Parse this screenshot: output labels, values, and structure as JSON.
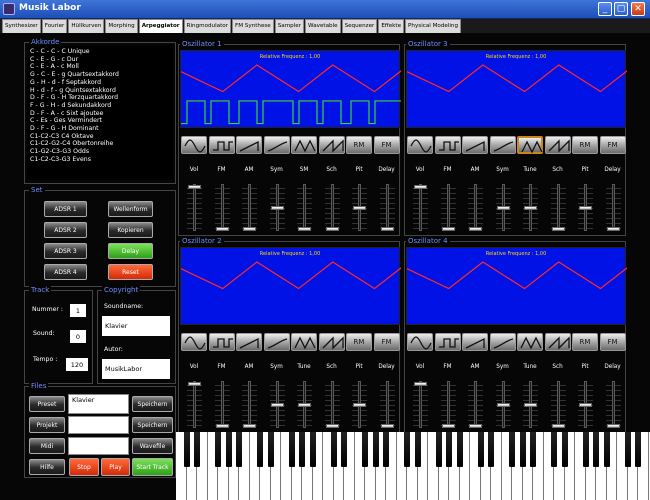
{
  "window": {
    "title": "Musik Labor"
  },
  "tabs": [
    "Synthesizer",
    "Fourier",
    "Hüllkurven",
    "Morphing",
    "Arpeggiator",
    "Ringmodulator",
    "FM Synthese",
    "Sampler",
    "Wavetable",
    "Sequenzer",
    "Effekte",
    "Physical Modeling"
  ],
  "active_tab": 4,
  "chords": {
    "title": "Akkorde",
    "items": [
      "C - C - C - C Unique",
      "C - E - G - c Dur",
      "C - E - A - c Moll",
      "G - C - E - g Quartsextakkord",
      "G - H - d - f Septakkord",
      "H - d - f - g Quintsextakkord",
      "D - F - G - H Terzquartakkord",
      "F - G - H - d Sekundakkord",
      "D - F - A - c Sixt ajoutee",
      "C - Es - Ges Vermindert",
      "D - F - G - H Dominant",
      "C1-C2-C3 C4 Oktave",
      "C1-C2-G2-C4 Obertonreihe",
      "C1-G2-C3-G3 Odds",
      "C1-C2-C3-G3 Evens"
    ]
  },
  "set": {
    "title": "Set",
    "adsr": [
      "ADSR 1",
      "ADSR 2",
      "ADSR 3",
      "ADSR 4"
    ],
    "wellenform": "Wellenform",
    "kopieren": "Kopieren",
    "delay": "Delay",
    "reset": "Reset"
  },
  "track": {
    "title": "Track",
    "nummer_label": "Nummer :",
    "nummer": "1",
    "sound_label": "Sound:",
    "sound": "0",
    "tempo_label": "Tempo :",
    "tempo": "120"
  },
  "copyright": {
    "title": "Copyright",
    "soundname_label": "Soundname:",
    "soundname": "Klavier",
    "autor_label": "Autor:",
    "autor": "MusikLabor"
  },
  "files": {
    "title": "Files",
    "left": [
      "Preset",
      "Projekt",
      "Midi",
      "Hilfe"
    ],
    "right": [
      "Speichern",
      "Speichern",
      "Wavefile"
    ],
    "entries": [
      "Klavier",
      "",
      "",
      ""
    ],
    "stop": "Stop",
    "play": "Play",
    "start_track": "Start Track"
  },
  "oscillators": [
    {
      "title": "Oszillator 1",
      "freq_text": "Relative Frequenz : 1,00",
      "waveform": "sawtooth",
      "selected_wave": -1,
      "show_square": true,
      "labels": [
        "Vol",
        "FM",
        "AM",
        "Sym",
        "SM",
        "Sch",
        "Pit",
        "Delay"
      ],
      "levels": [
        0.97,
        0.0,
        0.0,
        0.5,
        0.0,
        0.0,
        0.5,
        0.0
      ]
    },
    {
      "title": "Oszillator 3",
      "freq_text": "Relative Frequenz : 1,00",
      "waveform": "sawtooth",
      "selected_wave": 4,
      "show_square": false,
      "labels": [
        "Vol",
        "FM",
        "AM",
        "Sym",
        "Tune",
        "Sch",
        "Pit",
        "Delay"
      ],
      "levels": [
        0.97,
        0.0,
        0.0,
        0.5,
        0.5,
        0.0,
        0.5,
        0.0
      ]
    },
    {
      "title": "Oszillator 2",
      "freq_text": "Relative Frequenz : 1,00",
      "waveform": "sawtooth",
      "selected_wave": -1,
      "show_square": false,
      "labels": [
        "Vol",
        "FM",
        "AM",
        "Sym",
        "Tune",
        "Sch",
        "Pit",
        "Delay"
      ],
      "levels": [
        0.97,
        0.0,
        0.0,
        0.5,
        0.5,
        0.0,
        0.5,
        0.0
      ]
    },
    {
      "title": "Oszillator 4",
      "freq_text": "Relative Frequenz : 1,00",
      "waveform": "sawtooth",
      "selected_wave": -1,
      "show_square": false,
      "labels": [
        "Vol",
        "FM",
        "AM",
        "Sym",
        "Tune",
        "Sch",
        "Pit",
        "Delay"
      ],
      "levels": [
        0.97,
        0.0,
        0.0,
        0.5,
        0.5,
        0.0,
        0.5,
        0.0
      ]
    }
  ],
  "wave_buttons": [
    "sine-wave-icon",
    "square-wave-icon",
    "ramp-wave-icon",
    "smooth-ramp-icon",
    "triangle-wave-icon",
    "sawtooth-wave-icon",
    "RM",
    "FM"
  ],
  "colors": {
    "accent": "#6e8cff",
    "screen": "#0012e6",
    "wave": "#ff2a2a",
    "square": "#3ad43a",
    "freq": "#ffd700"
  }
}
